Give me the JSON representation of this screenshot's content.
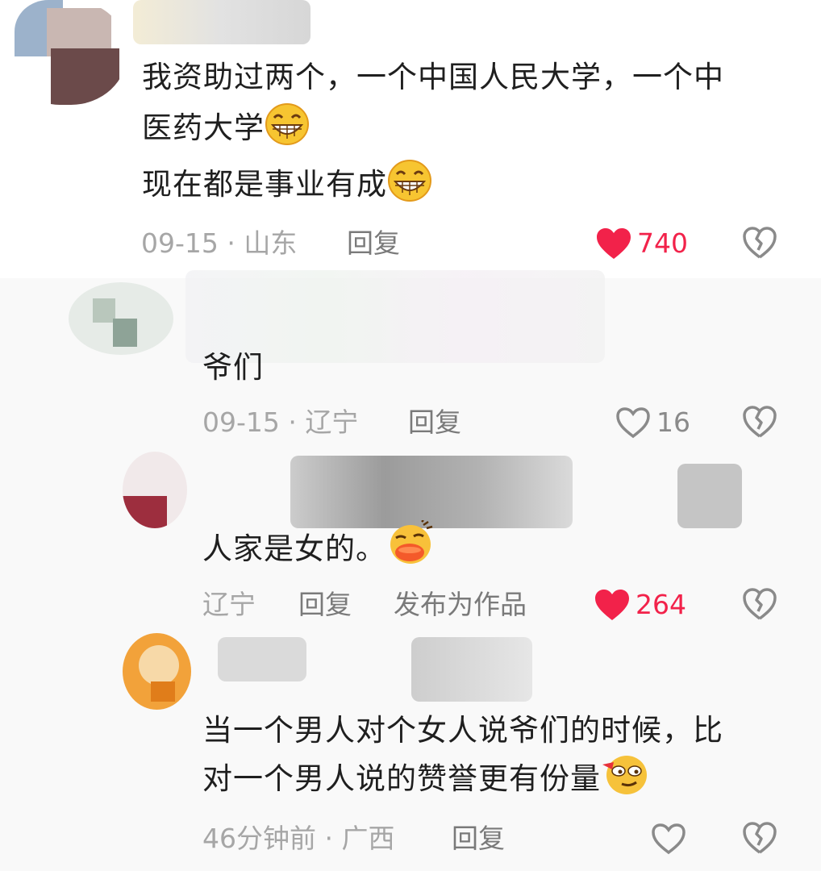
{
  "colors": {
    "like_active": "#f2224a",
    "meta": "#a6a6a6",
    "action": "#7a7a7a",
    "text": "#1f1f1f"
  },
  "comments": [
    {
      "lines": [
        "我资助过两个，一个中国人民大学，一个中",
        "医药大学"
      ],
      "line3": "现在都是事业有成",
      "emojis": [
        "grin-emoji",
        "grin-emoji"
      ],
      "meta": "09-15 · 山东",
      "reply": "回复",
      "likes": "740",
      "liked": true
    },
    {
      "text": "爷们",
      "meta": "09-15 · 辽宁",
      "reply": "回复",
      "likes": "16",
      "liked": false
    },
    {
      "text": "人家是女的。",
      "emoji": "smug-duck-emoji",
      "meta": "辽宁",
      "reply": "回复",
      "extra_action": "发布为作品",
      "likes": "264",
      "liked": true
    },
    {
      "lines": [
        "当一个男人对个女人说爷们的时候，比",
        "对一个男人说的赞誉更有份量"
      ],
      "emoji": "sly-face-emoji",
      "meta": "46分钟前 · 广西",
      "reply": "回复",
      "likes": "",
      "liked": false
    }
  ]
}
